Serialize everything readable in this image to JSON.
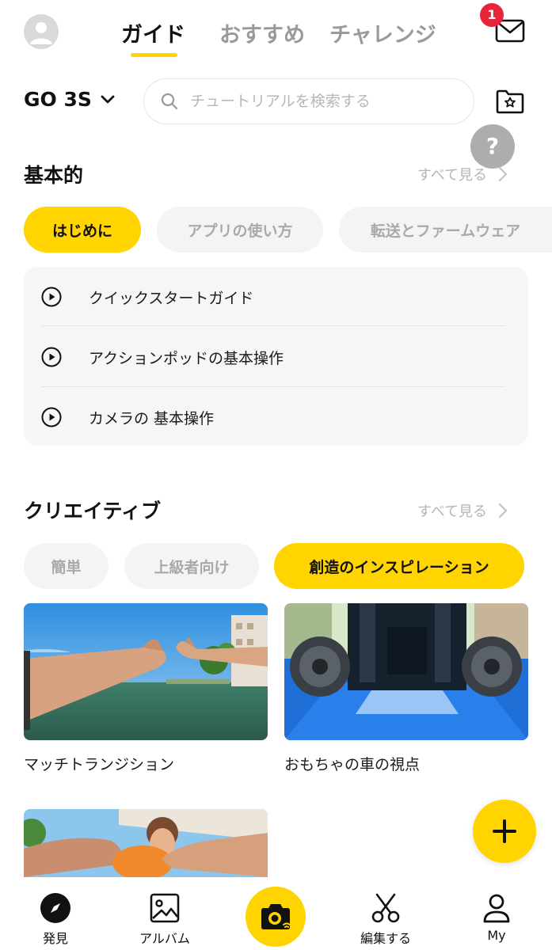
{
  "header": {
    "tabs": [
      {
        "label": "ガイド",
        "active": true
      },
      {
        "label": "おすすめ",
        "active": false
      },
      {
        "label": "チャレンジ",
        "active": false
      }
    ],
    "mail_badge": "1"
  },
  "device": {
    "name": "GO 3S"
  },
  "search": {
    "placeholder": "チュートリアルを検索する"
  },
  "help": {
    "label": "?"
  },
  "basic": {
    "title": "基本的",
    "see_all": "すべて見る",
    "pills": [
      "はじめに",
      "アプリの使い方",
      "転送とファームウェア"
    ],
    "items": [
      "クイックスタートガイド",
      "アクションポッドの基本操作",
      "カメラの 基本操作"
    ]
  },
  "creative": {
    "title": "クリエイティブ",
    "see_all": "すべて見る",
    "pills": [
      "簡単",
      "上級者向け",
      "創造のインスピレーション"
    ],
    "videos": [
      "マッチトランジション",
      "おもちゃの車の視点"
    ]
  },
  "bottom_nav": {
    "items": [
      "発見",
      "アルバム",
      "編集する",
      "My"
    ]
  },
  "colors": {
    "accent": "#ffd400",
    "badge": "#e8243a",
    "muted_text": "#a9a9a9",
    "pill_bg": "#f4f4f6"
  }
}
